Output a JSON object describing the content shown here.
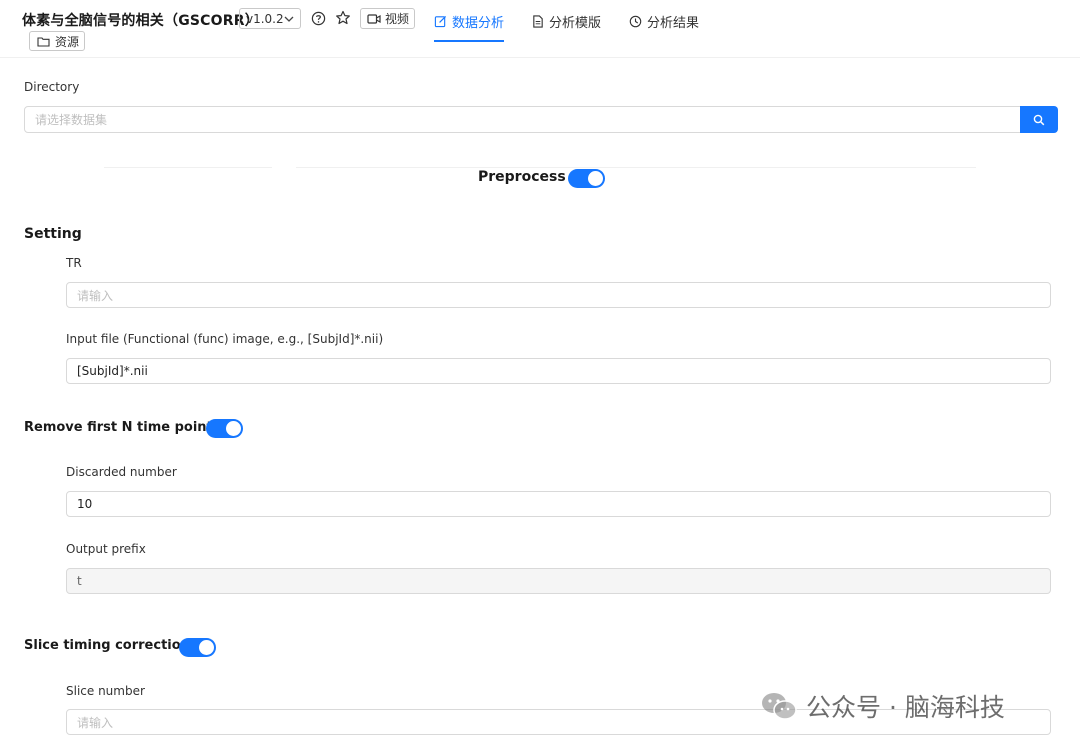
{
  "header": {
    "title": "体素与全脑信号的相关（GSCORR）",
    "version": "v1.0.2",
    "video_label": "视频",
    "resource_label": "资源",
    "tabs": [
      {
        "label": "数据分析",
        "icon": "edit-icon",
        "active": true
      },
      {
        "label": "分析模版",
        "icon": "file-icon",
        "active": false
      },
      {
        "label": "分析结果",
        "icon": "history-icon",
        "active": false
      }
    ]
  },
  "directory": {
    "label": "Directory",
    "placeholder": "请选择数据集"
  },
  "preprocess": {
    "label": "Preprocess",
    "enabled": true
  },
  "setting": {
    "title": "Setting",
    "tr_label": "TR",
    "tr_placeholder": "请输入",
    "input_file_label": "Input file (Functional (func) image, e.g., [SubjId]*.nii)",
    "input_file_value": "[SubjId]*.nii"
  },
  "remove_first": {
    "title": "Remove first N time points",
    "enabled": true,
    "discarded_label": "Discarded number",
    "discarded_value": "10",
    "prefix_label": "Output prefix",
    "prefix_value": "t"
  },
  "slice_timing": {
    "title": "Slice timing correction",
    "enabled": true,
    "slice_number_label": "Slice number",
    "slice_number_placeholder": "请输入"
  },
  "watermark": {
    "text": "公众号 · 脑海科技"
  },
  "colors": {
    "accent": "#1677ff",
    "border": "#d9d9d9"
  }
}
